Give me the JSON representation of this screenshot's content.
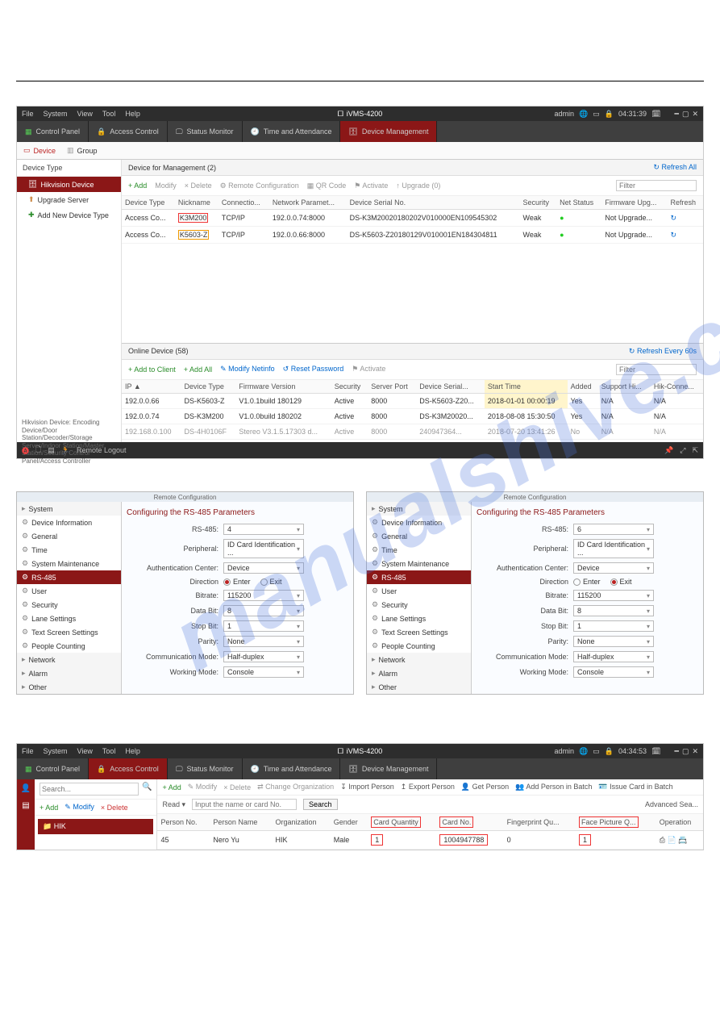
{
  "watermark": "manualshive.com",
  "app1": {
    "menu": {
      "items": [
        "File",
        "System",
        "View",
        "Tool",
        "Help"
      ],
      "title": "iVMS-4200",
      "user": "admin",
      "time": "04:31:39"
    },
    "tabs": [
      {
        "icon": "grid",
        "label": "Control Panel"
      },
      {
        "icon": "lock",
        "label": "Access Control"
      },
      {
        "icon": "monitor",
        "label": "Status Monitor"
      },
      {
        "icon": "clock",
        "label": "Time and Attendance"
      },
      {
        "icon": "device",
        "label": "Device Management"
      }
    ],
    "subtabs": [
      {
        "icon": "device",
        "label": "Device"
      },
      {
        "icon": "group",
        "label": "Group"
      }
    ],
    "left": {
      "header": "Device Type",
      "items": [
        {
          "label": "Hikvision Device",
          "kind": "sel"
        },
        {
          "label": "Upgrade Server",
          "kind": "srv"
        },
        {
          "label": "Add New Device Type",
          "kind": "add"
        }
      ],
      "desc": "Hikvision Device: Encoding Device/Door Station/Decoder/Storage Server/Indoor Station/Master Station/Security Control Panel/Access Controller"
    },
    "pane1": {
      "title": "Device for Management (2)",
      "refresh": "Refresh All",
      "toolbar": [
        "+ Add",
        "Modify",
        "× Delete",
        "Remote Configuration",
        "QR Code",
        "Activate",
        "Upgrade (0)"
      ],
      "filter": "Filter",
      "cols": [
        "Device Type",
        "Nickname",
        "Connectio...",
        "Network Paramet...",
        "Device Serial No.",
        "Security",
        "Net Status",
        "Firmware Upg...",
        "Refresh"
      ],
      "rows": [
        {
          "dt": "Access Co...",
          "nn": "K3M200",
          "conn": "TCP/IP",
          "np": "192.0.0.74:8000",
          "sn": "DS-K3M20020180202V010000EN109545302",
          "sec": "Weak",
          "ns": "●",
          "fw": "Not Upgrade...",
          "rf": "↻"
        },
        {
          "dt": "Access Co...",
          "nn": "K5603-Z",
          "conn": "TCP/IP",
          "np": "192.0.0.66:8000",
          "sn": "DS-K5603-Z20180129V010001EN184304811",
          "sec": "Weak",
          "ns": "●",
          "fw": "Not Upgrade...",
          "rf": "↻"
        }
      ]
    },
    "pane2": {
      "title": "Online Device (58)",
      "refresh": "Refresh Every 60s",
      "toolbar": [
        "+ Add to Client",
        "+ Add All",
        "Modify Netinfo",
        "Reset Password",
        "Activate"
      ],
      "filter": "Filter",
      "cols": [
        "IP",
        "Device Type",
        "Firmware Version",
        "Security",
        "Server Port",
        "Device Serial...",
        "Start Time",
        "Added",
        "Support Hi...",
        "Hik-Conne..."
      ],
      "rows": [
        {
          "ip": "192.0.0.66",
          "dt": "DS-K5603-Z",
          "fw": "V1.0.1build 180129",
          "sec": "Active",
          "port": "8000",
          "sn": "DS-K5603-Z20...",
          "st": "2018-01-01 00:00:19",
          "add": "Yes",
          "sh": "N/A",
          "hc": "N/A"
        },
        {
          "ip": "192.0.0.74",
          "dt": "DS-K3M200",
          "fw": "V1.0.0build 180202",
          "sec": "Active",
          "port": "8000",
          "sn": "DS-K3M20020...",
          "st": "2018-08-08 15:30:50",
          "add": "Yes",
          "sh": "N/A",
          "hc": "N/A"
        },
        {
          "ip": "192.168.0.100",
          "dt": "DS-4H0106F",
          "fw": "Stereo V3.1.5.17303 d...",
          "sec": "Active",
          "port": "8000",
          "sn": "240947364...",
          "st": "2018-07-20 13:41:26",
          "add": "No",
          "sh": "N/A",
          "hc": "N/A"
        }
      ]
    },
    "status": {
      "motion": "Remote Logout"
    }
  },
  "rs": {
    "bar": "Remote Configuration",
    "tree": [
      {
        "label": "System",
        "type": "hdr"
      },
      {
        "label": "Device Information"
      },
      {
        "label": "General"
      },
      {
        "label": "Time"
      },
      {
        "label": "System Maintenance"
      },
      {
        "label": "RS-485",
        "sel": true
      },
      {
        "label": "User"
      },
      {
        "label": "Security"
      },
      {
        "label": "Lane Settings"
      },
      {
        "label": "Text Screen Settings"
      },
      {
        "label": "People Counting"
      },
      {
        "label": "Network",
        "type": "hdr"
      },
      {
        "label": "Alarm",
        "type": "hdr"
      },
      {
        "label": "Other",
        "type": "hdr"
      }
    ],
    "title": "Configuring the RS-485 Parameters",
    "paneA": {
      "fields": [
        {
          "l": "RS-485:",
          "v": "4"
        },
        {
          "l": "Peripheral:",
          "v": "ID Card Identification ..."
        },
        {
          "l": "Authentication Center:",
          "v": "Device"
        },
        {
          "l": "Direction",
          "radios": [
            "Enter",
            "Exit"
          ],
          "sel": "Enter"
        },
        {
          "l": "Bitrate:",
          "v": "115200"
        },
        {
          "l": "Data Bit:",
          "v": "8"
        },
        {
          "l": "Stop Bit:",
          "v": "1"
        },
        {
          "l": "Parity:",
          "v": "None"
        },
        {
          "l": "Communication Mode:",
          "v": "Half-duplex"
        },
        {
          "l": "Working Mode:",
          "v": "Console"
        }
      ]
    },
    "paneB": {
      "fields": [
        {
          "l": "RS-485:",
          "v": "6"
        },
        {
          "l": "Peripheral:",
          "v": "ID Card Identification ..."
        },
        {
          "l": "Authentication Center:",
          "v": "Device"
        },
        {
          "l": "Direction",
          "radios": [
            "Enter",
            "Exit"
          ],
          "sel": "Exit"
        },
        {
          "l": "Bitrate:",
          "v": "115200"
        },
        {
          "l": "Data Bit:",
          "v": "8"
        },
        {
          "l": "Stop Bit:",
          "v": "1"
        },
        {
          "l": "Parity:",
          "v": "None"
        },
        {
          "l": "Communication Mode:",
          "v": "Half-duplex"
        },
        {
          "l": "Working Mode:",
          "v": "Console"
        }
      ]
    }
  },
  "app2": {
    "menu": {
      "items": [
        "File",
        "System",
        "View",
        "Tool",
        "Help"
      ],
      "title": "iVMS-4200",
      "user": "admin",
      "time": "04:34:53"
    },
    "tabs": [
      {
        "label": "Control Panel"
      },
      {
        "label": "Access Control"
      },
      {
        "label": "Status Monitor"
      },
      {
        "label": "Time and Attendance"
      },
      {
        "label": "Device Management"
      }
    ],
    "search_ph": "Search...",
    "orgtoolbar": [
      "+ Add",
      "Modify",
      "× Delete"
    ],
    "org": "HIK",
    "toprow": [
      "+ Add",
      "Modify",
      "× Delete",
      "Change Organization",
      "Import Person",
      "Export Person",
      "Get Person",
      "Add Person in Batch",
      "Issue Card in Batch"
    ],
    "readrow": {
      "read": "Read",
      "ph": "Input the name or card No.",
      "search": "Search",
      "adv": "Advanced Sea..."
    },
    "cols": [
      "Person No.",
      "Person Name",
      "Organization",
      "Gender",
      "Card Quantity",
      "Card No.",
      "Fingerprint Qu...",
      "Face Picture Q...",
      "Operation"
    ],
    "row": {
      "no": "45",
      "name": "Nero Yu",
      "org": "HIK",
      "gender": "Male",
      "cq": "1",
      "cn": "1004947788",
      "fp": "0",
      "fq": "1",
      "op": "⎙ 📄 📇"
    }
  }
}
